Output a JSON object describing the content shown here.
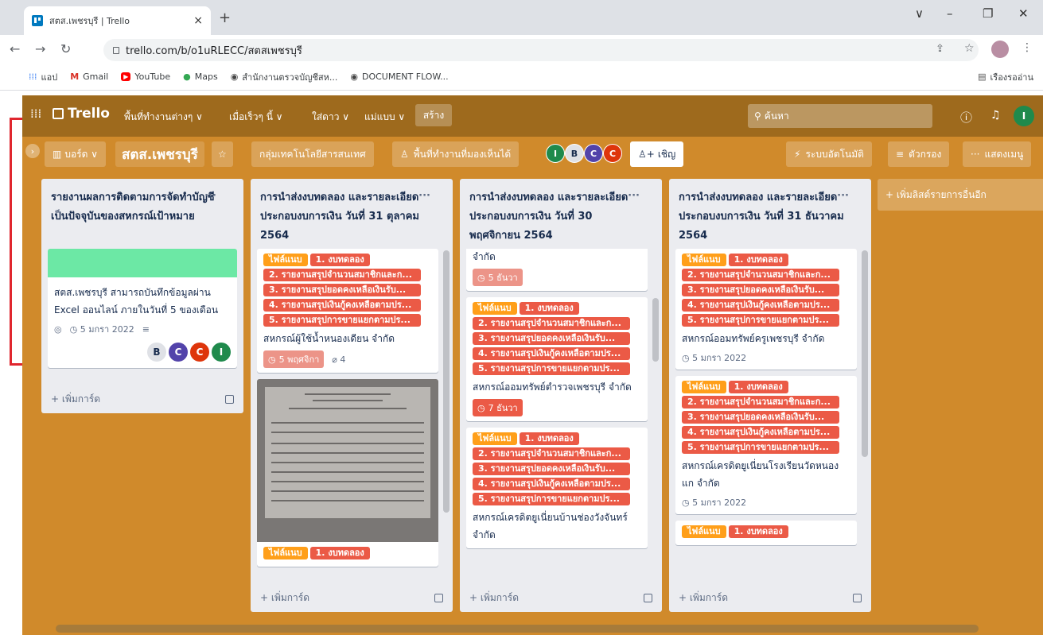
{
  "browser": {
    "tab_title": "สตส.เพชรบุรี | Trello",
    "address": "trello.com/b/o1uRLECC/สตสเพชรบุรี",
    "bookmarks": [
      "แอป",
      "Gmail",
      "YouTube",
      "Maps",
      "สำนักงานตรวจบัญชีสห...",
      "DOCUMENT FLOW..."
    ],
    "reading_list": "เรืองรออ่าน"
  },
  "trello": {
    "logo": "Trello",
    "menus": [
      "พื้นที่ทำงานต่างๆ ∨",
      "เมื่อเร็วๆ นี้ ∨",
      "ใส่ดาว ∨",
      "แม่แบบ ∨"
    ],
    "create": "สร้าง",
    "search": "ค้นหา",
    "user_initial": "I"
  },
  "board": {
    "view": "บอร์ด ∨",
    "title": "สตส.เพชรบุรี",
    "workspace": "กลุ่มเทคโนโลยีสารสนเทศ",
    "visibility": "พื้นที่ทำงานที่มองเห็นได้",
    "members": [
      "I",
      "B",
      "C",
      "C"
    ],
    "invite": "เชิญ",
    "automation": "ระบบอัตโนมัติ",
    "filter": "ตัวกรอง",
    "menu": "แสดงเมนู",
    "add_list": "+ เพิ่มลิสต์รายการอื่นอีก",
    "add_card": "+ เพิ่มการ์ด"
  },
  "labels": {
    "attach": "ไฟล์แนบ",
    "exp": "1. งบทดลอง",
    "l2": "2. รายงานสรุปจำนวนสมาชิกและก...",
    "l3": "3. รายงานสรุปยอดคงเหลือเงินรับ...",
    "l4": "4. รายงานสรุปเงินกู้คงเหลือตามปร...",
    "l5": "5. รายงานสรุปการขายแยกตามปร..."
  },
  "lists": [
    {
      "title": "รายงานผลการติดตามการจัดทำบัญชีเป็นปัจจุบันของสหกรณ์เป้าหมาย",
      "card": {
        "title": "สตส.เพชรบุรี สามารถบันทึกข้อมูลผ่าน Excel ออนไลน์ ภายในวันที่ 5 ของเดือน",
        "due": "5 มกรา 2022",
        "members": [
          "B",
          "C",
          "C",
          "I"
        ]
      }
    },
    {
      "title": "การนำส่งงบทดลอง และรายละเอียดประกอบงบการเงิน วันที่ 31 ตุลาคม 2564",
      "card1": {
        "title": "สหกรณ์ผู้ใช้น้ำหนองเดียน จำกัด",
        "due": "5 พฤศจิกา",
        "attachments": "4"
      }
    },
    {
      "title": "การนำส่งงบทดลอง และรายละเอียดประกอบงบการเงิน วันที่ 30 พฤศจิกายน 2564",
      "card0": {
        "tail": "จำกัด",
        "due": "5 ธันวา"
      },
      "card1": {
        "title": "สหกรณ์ออมทรัพย์ตำรวจเพชรบุรี จำกัด",
        "due": "7 ธันวา"
      },
      "card2": {
        "title": "สหกรณ์เครดิตยูเนี่ยนบ้านช่องวังจันทร์ จำกัด"
      }
    },
    {
      "title": "การนำส่งงบทดลอง และรายละเอียดประกอบงบการเงิน วันที่ 31 ธันวาคม 2564",
      "card1": {
        "title": "สหกรณ์ออมทรัพย์ครูเพชรบุรี จำกัด",
        "due": "5 มกรา 2022"
      },
      "card2": {
        "title": "สหกรณ์เครดิตยูเนี่ยนโรงเรียนวัดหนองแก จำกัด",
        "due": "5 มกรา 2022"
      }
    }
  ]
}
